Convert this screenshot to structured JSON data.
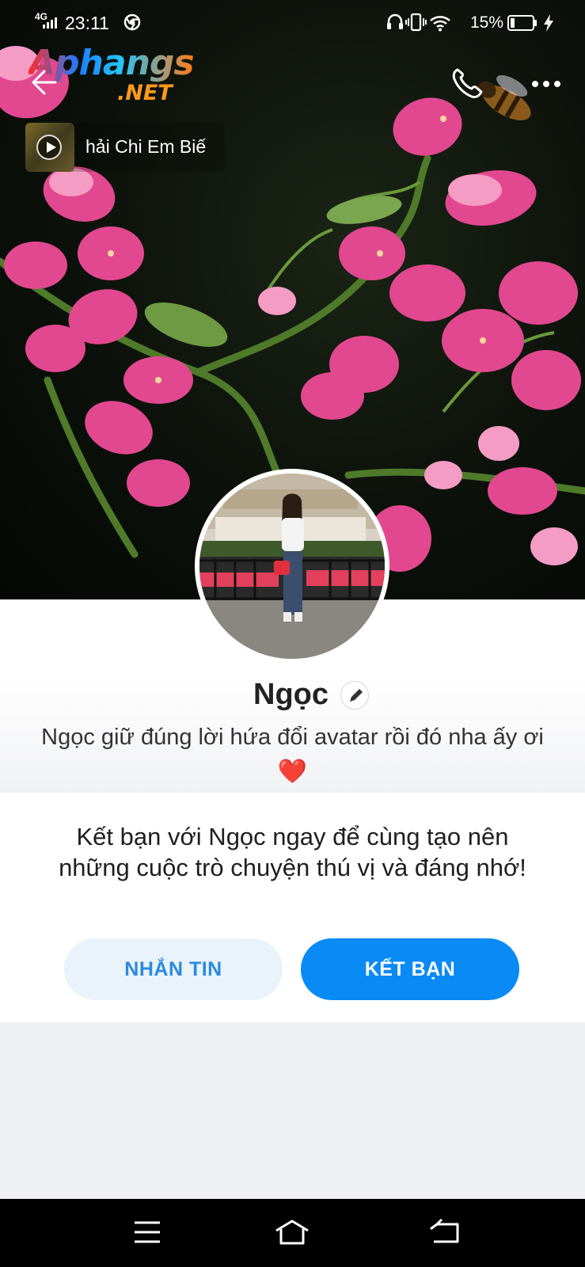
{
  "status_bar": {
    "network": "4G",
    "time": "23:11",
    "battery_percent": "15%",
    "icons": [
      "signal-icon",
      "chrome-icon",
      "headphones-icon",
      "vibrate-icon",
      "wifi-icon",
      "battery-icon",
      "charging-icon"
    ]
  },
  "watermark": {
    "line1": "Aphangs",
    "line2": ".NET"
  },
  "header": {
    "back_icon": "back-arrow-icon",
    "call_icon": "phone-icon",
    "more_icon": "more-icon"
  },
  "music": {
    "title": "hải Chi Em Biế"
  },
  "profile": {
    "name": "Ngọc",
    "bio": "Ngọc giữ đúng lời hứa đổi avatar rồi đó nha ấy ơi",
    "bio_emoji": "❤️"
  },
  "friend_prompt": {
    "text": "Kết bạn với Ngọc ngay để cùng tạo nên những cuộc trò chuyện thú vị và đáng nhớ!",
    "message_label": "NHẮN TIN",
    "add_friend_label": "KẾT BẠN"
  },
  "colors": {
    "primary": "#0a8af5",
    "secondary_bg": "#eaf2fa",
    "secondary_text": "#2a8be0",
    "page_bg": "#eef0f3"
  },
  "nav_bar": {
    "icons": [
      "menu-icon",
      "home-icon",
      "back-icon"
    ]
  }
}
